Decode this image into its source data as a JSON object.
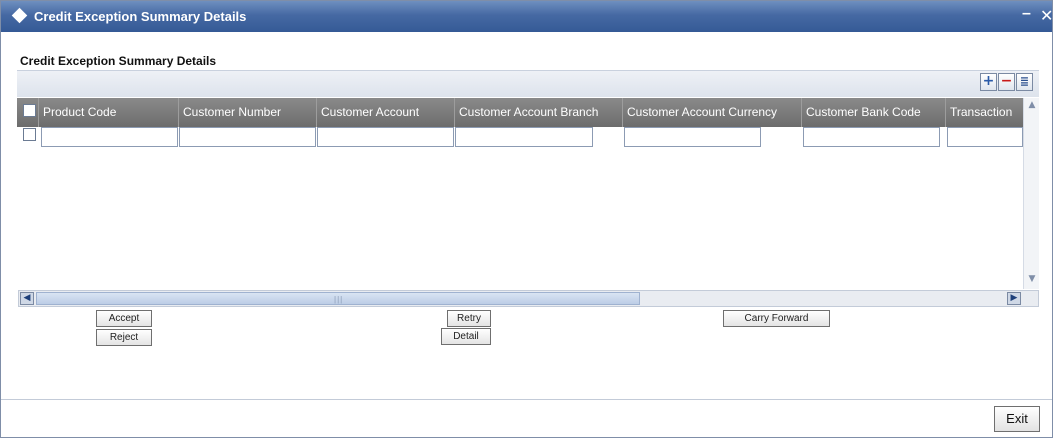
{
  "window": {
    "title": "Credit Exception Summary Details",
    "minimize_glyph": "–",
    "close_glyph": "✕"
  },
  "section": {
    "title": "Credit Exception Summary Details"
  },
  "toolbar": {
    "add_icon": "+",
    "delete_icon": "−",
    "list_icon": "≣"
  },
  "grid": {
    "columns": [
      "Product Code",
      "Customer Number",
      "Customer Account",
      "Customer Account Branch",
      "Customer Account Currency",
      "Customer Bank Code",
      "Transaction"
    ],
    "rows": [
      [
        "",
        "",
        "",
        "",
        "",
        "",
        ""
      ]
    ]
  },
  "scroll": {
    "up": "▲",
    "down": "▼",
    "left": "◀",
    "right": "▶",
    "grip": "|||"
  },
  "actions": {
    "accept": "Accept",
    "reject": "Reject",
    "retry": "Retry",
    "detail": "Detail",
    "carry_forward": "Carry Forward"
  },
  "footer": {
    "exit": "Exit"
  },
  "colors": {
    "titlebar": "#4669a3",
    "grid_header": "#7a7a7a"
  }
}
